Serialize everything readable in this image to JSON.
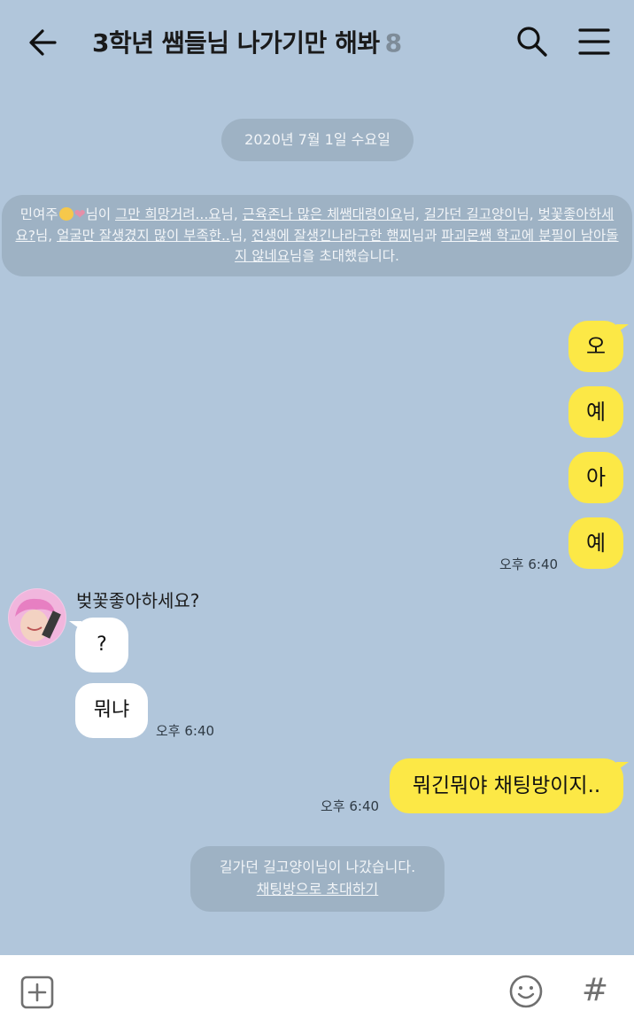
{
  "header": {
    "title": "3학년 쌤들님 나가기만 해봐",
    "member_count": "8",
    "back_icon": "arrow-left-icon",
    "search_icon": "search-icon",
    "menu_icon": "hamburger-menu-icon"
  },
  "date_divider": "2020년 7월 1일 수요일",
  "invite_notice": {
    "inviter": "민여주",
    "text_after_inviter": "님이 ",
    "invitees": [
      "그만 희망거려...요",
      "근육존나 많은 체쌤대령이요",
      "길가던 길고양이",
      "벚꽃좋아하세요?",
      "얼굴만 잘생겼지 많이 부족한..",
      "전생에 잘생긴나라구한 햄찌",
      "파괴몬쌤 학교에 분필이 남아돌지 않네요"
    ],
    "suffix_nim": "님",
    "joiner": ", ",
    "joiner_last": "과 ",
    "ending": "을 초대했습니다."
  },
  "my_messages": [
    {
      "text": "오"
    },
    {
      "text": "예"
    },
    {
      "text": "아"
    },
    {
      "text": "예"
    }
  ],
  "my_time_1": "오후 6:40",
  "other": {
    "sender": "벚꽃좋아하세요?",
    "messages": [
      {
        "text": "?"
      },
      {
        "text": "뭐냐"
      }
    ],
    "time": "오후 6:40"
  },
  "my_reply": {
    "text": "뭐긴뭐야 채팅방이지..",
    "time": "오후 6:40"
  },
  "leave_notice": {
    "text": "길가던 길고양이님이 나갔습니다.",
    "link": "채팅방으로 초대하기"
  },
  "input_bar": {
    "plus_icon": "plus-square-icon",
    "emoji_icon": "smiley-icon",
    "hash_label": "#"
  },
  "colors": {
    "background": "#b1c6db",
    "my_bubble": "#fce846",
    "other_bubble": "#ffffff",
    "system_pill": "#9eb2c4"
  }
}
